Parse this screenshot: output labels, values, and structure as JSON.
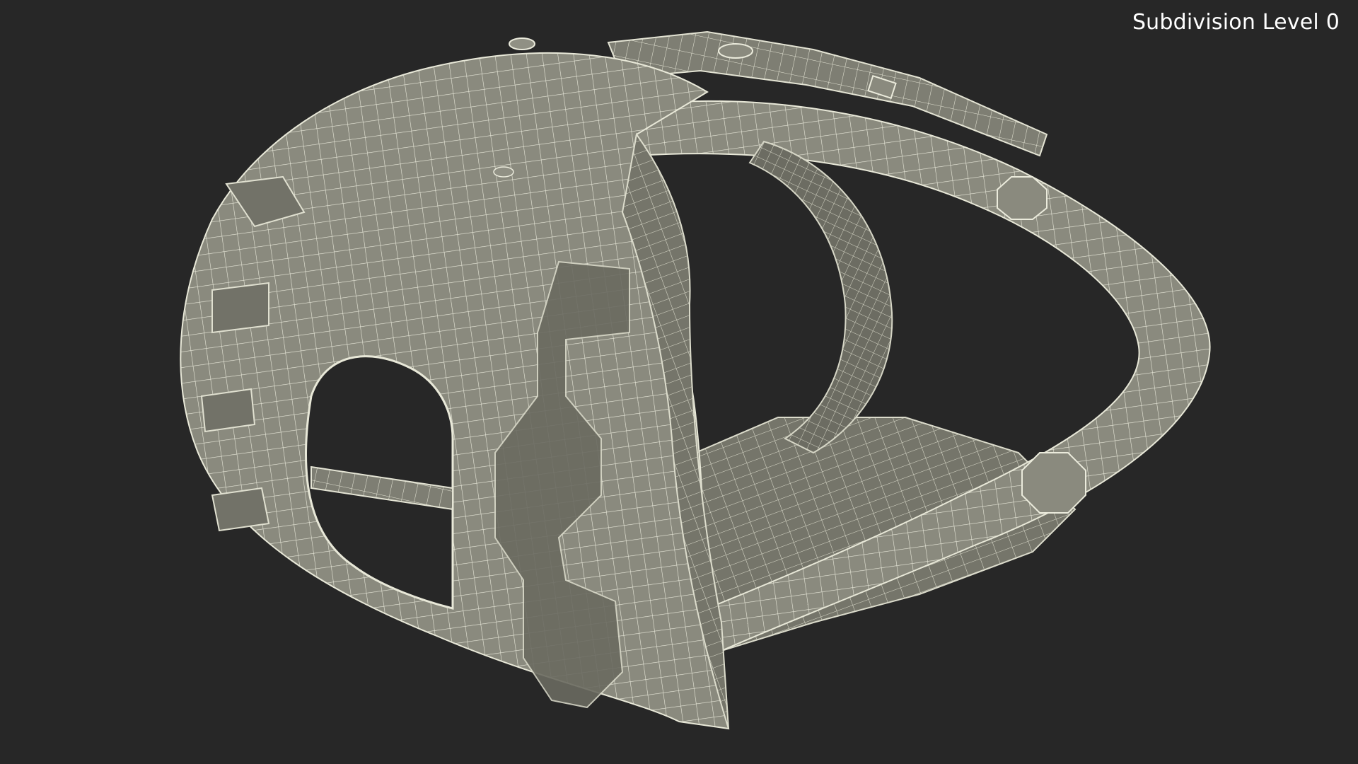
{
  "viewport": {
    "subdivision_label": "Subdivision Level 0",
    "background_color": "#272727"
  },
  "model": {
    "subject": "3D wireframe mesh of a VR headset facial interface",
    "surface_color": "#88887c",
    "wire_color": "#e8e8d8",
    "shadow_color": "#5e5e54"
  }
}
